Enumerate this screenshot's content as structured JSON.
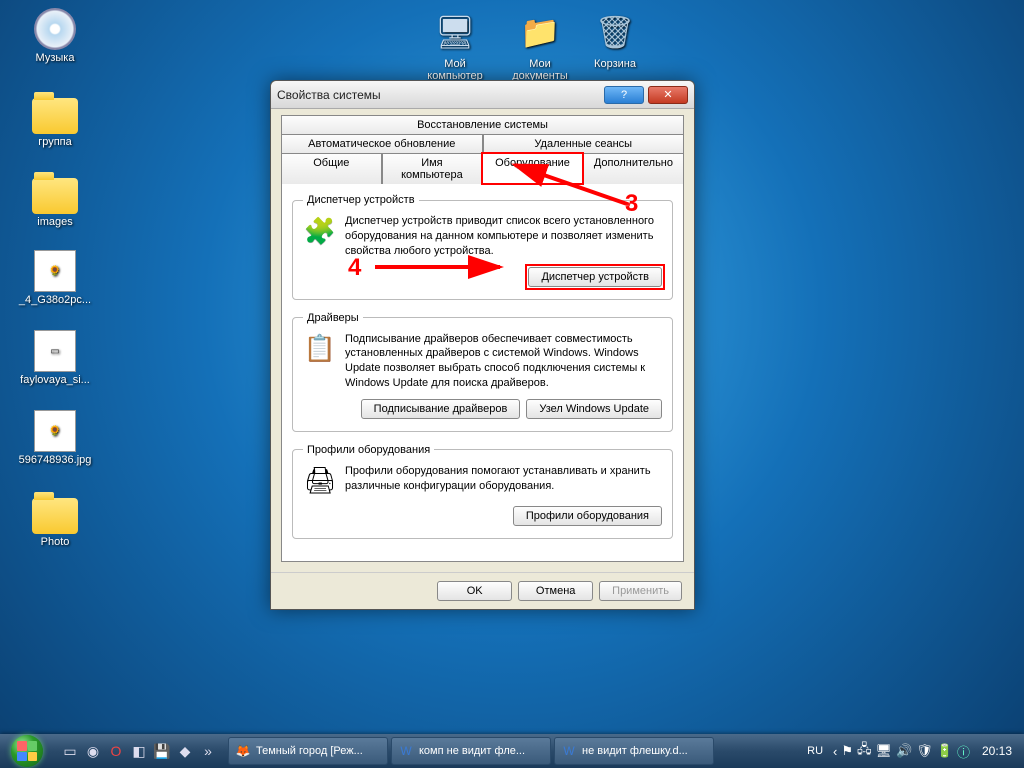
{
  "desktop": {
    "icons": [
      {
        "label": "Музыка",
        "kind": "disc"
      },
      {
        "label": "группа",
        "kind": "folder"
      },
      {
        "label": "images",
        "kind": "folder"
      },
      {
        "label": "_4_G38o2pc...",
        "kind": "thumb"
      },
      {
        "label": "faylovaya_si...",
        "kind": "thumb"
      },
      {
        "label": "596748936.jpg",
        "kind": "thumb"
      },
      {
        "label": "Photo",
        "kind": "folder"
      }
    ],
    "top_icons": [
      {
        "label": "Мой компьютер",
        "kind": "computer",
        "glyph": "🖥"
      },
      {
        "label": "Мои документы",
        "kind": "docfolder",
        "glyph": "📁"
      },
      {
        "label": "Корзина",
        "kind": "trash",
        "glyph": "🗑"
      }
    ]
  },
  "dialog": {
    "title": "Свойства системы",
    "tabs_row1": [
      "Восстановление системы"
    ],
    "tabs_row2": [
      "Автоматическое обновление",
      "Удаленные сеансы"
    ],
    "tabs_row3": [
      "Общие",
      "Имя компьютера",
      "Оборудование",
      "Дополнительно"
    ],
    "active_tab": "Оборудование",
    "group1": {
      "legend": "Диспетчер устройств",
      "text": "Диспетчер устройств приводит список всего установленного оборудования на данном компьютере и позволяет изменить свойства любого устройства.",
      "button": "Диспетчер устройств"
    },
    "group2": {
      "legend": "Драйверы",
      "text": "Подписывание драйверов обеспечивает совместимость установленных драйверов с системой Windows.  Windows Update позволяет выбрать способ подключения системы к Windows Update для поиска драйверов.",
      "button1": "Подписывание драйверов",
      "button2": "Узел Windows Update"
    },
    "group3": {
      "legend": "Профили оборудования",
      "text": "Профили оборудования помогают устанавливать и хранить различные конфигурации оборудования.",
      "button": "Профили оборудования"
    },
    "buttons": {
      "ok": "OK",
      "cancel": "Отмена",
      "apply": "Применить"
    }
  },
  "annotations": {
    "n3": "3",
    "n4": "4"
  },
  "taskbar": {
    "items": [
      {
        "icon": "🦊",
        "label": "Темный город [Реж..."
      },
      {
        "icon": "📄",
        "label": "комп не видит фле..."
      },
      {
        "icon": "📄",
        "label": "не видит флешку.d..."
      }
    ],
    "lang": "RU",
    "clock": "20:13"
  }
}
